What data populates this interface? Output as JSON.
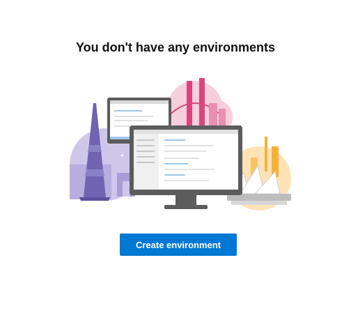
{
  "empty_state": {
    "title": "You don't have any environments",
    "illustration": "city-landmarks-monitors",
    "create_button_label": "Create environment"
  },
  "colors": {
    "accent": "#0078d4",
    "heading": "#111111",
    "purple": "#6f63b2",
    "pink": "#d8467b",
    "amber": "#f5b23b"
  }
}
